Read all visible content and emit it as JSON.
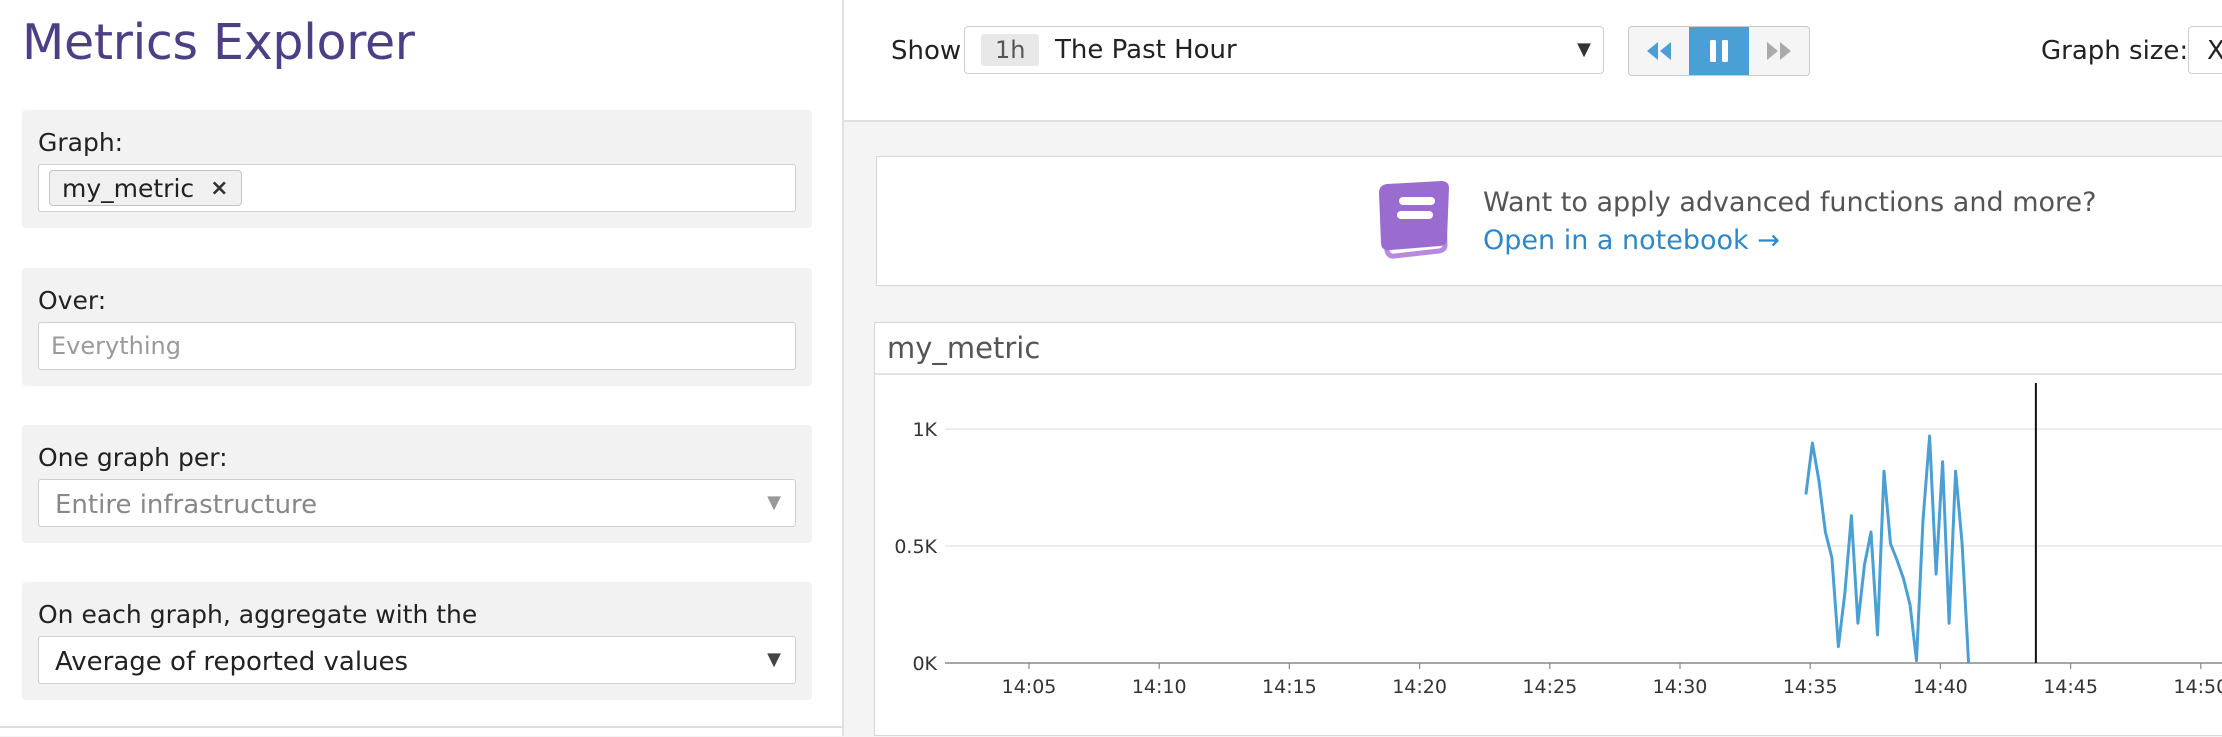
{
  "app": {
    "title": "Metrics Explorer"
  },
  "left_panel": {
    "graph": {
      "label": "Graph:",
      "tags": [
        "my_metric"
      ],
      "remove_symbol": "×"
    },
    "over": {
      "label": "Over:",
      "placeholder": "Everything"
    },
    "one_graph_per": {
      "label": "One graph per:",
      "placeholder": "Entire infrastructure"
    },
    "aggregate": {
      "label": "On each graph, aggregate with the",
      "value": "Average of reported values"
    }
  },
  "toolbar": {
    "show_label": "Show",
    "time_badge": "1h",
    "time_value": "The Past Hour",
    "playback": {
      "rewind_icon": "rewind-icon",
      "pause_icon": "pause-icon",
      "forward_icon": "fast-forward-icon",
      "active": "pause"
    },
    "graph_size_label": "Graph size:",
    "graph_size_value": "X"
  },
  "banner": {
    "icon": "notebook-icon",
    "text": "Want to apply advanced functions and more?",
    "link": "Open in a notebook →"
  },
  "colors": {
    "accent": "#4a9fd5",
    "title": "#4c3f86",
    "link": "#2f88c5",
    "notebook": "#9b6cd0"
  },
  "chart_data": {
    "type": "line",
    "title": "my_metric",
    "series": [
      {
        "color": "#4a9fd5",
        "x": [
          "14:34:50",
          "14:35:05",
          "14:35:20",
          "14:35:35",
          "14:35:50",
          "14:36:05",
          "14:36:20",
          "14:36:35",
          "14:36:50",
          "14:37:05",
          "14:37:20",
          "14:37:35",
          "14:37:50",
          "14:38:05",
          "14:38:20",
          "14:38:35",
          "14:38:50",
          "14:39:05",
          "14:39:20",
          "14:39:35",
          "14:39:50",
          "14:40:05",
          "14:40:20",
          "14:40:35",
          "14:40:50",
          "14:41:05",
          "14:41:20",
          "14:41:35"
        ],
        "values": [
          720,
          940,
          780,
          560,
          450,
          70,
          300,
          630,
          170,
          420,
          560,
          120,
          820,
          510,
          440,
          360,
          250,
          10,
          610,
          970,
          380,
          860,
          170,
          820,
          510,
          0,
          0,
          0
        ]
      }
    ],
    "x_ticks": [
      "14:05",
      "14:10",
      "14:15",
      "14:20",
      "14:25",
      "14:30",
      "14:35",
      "14:40",
      "14:45",
      "14:50"
    ],
    "y_ticks": [
      "0K",
      "0.5K",
      "1K"
    ],
    "ylim": [
      0,
      1000
    ],
    "xlim": [
      "14:02",
      "14:51"
    ],
    "current_time_marker": "14:43:40",
    "grid": "horizontal"
  }
}
